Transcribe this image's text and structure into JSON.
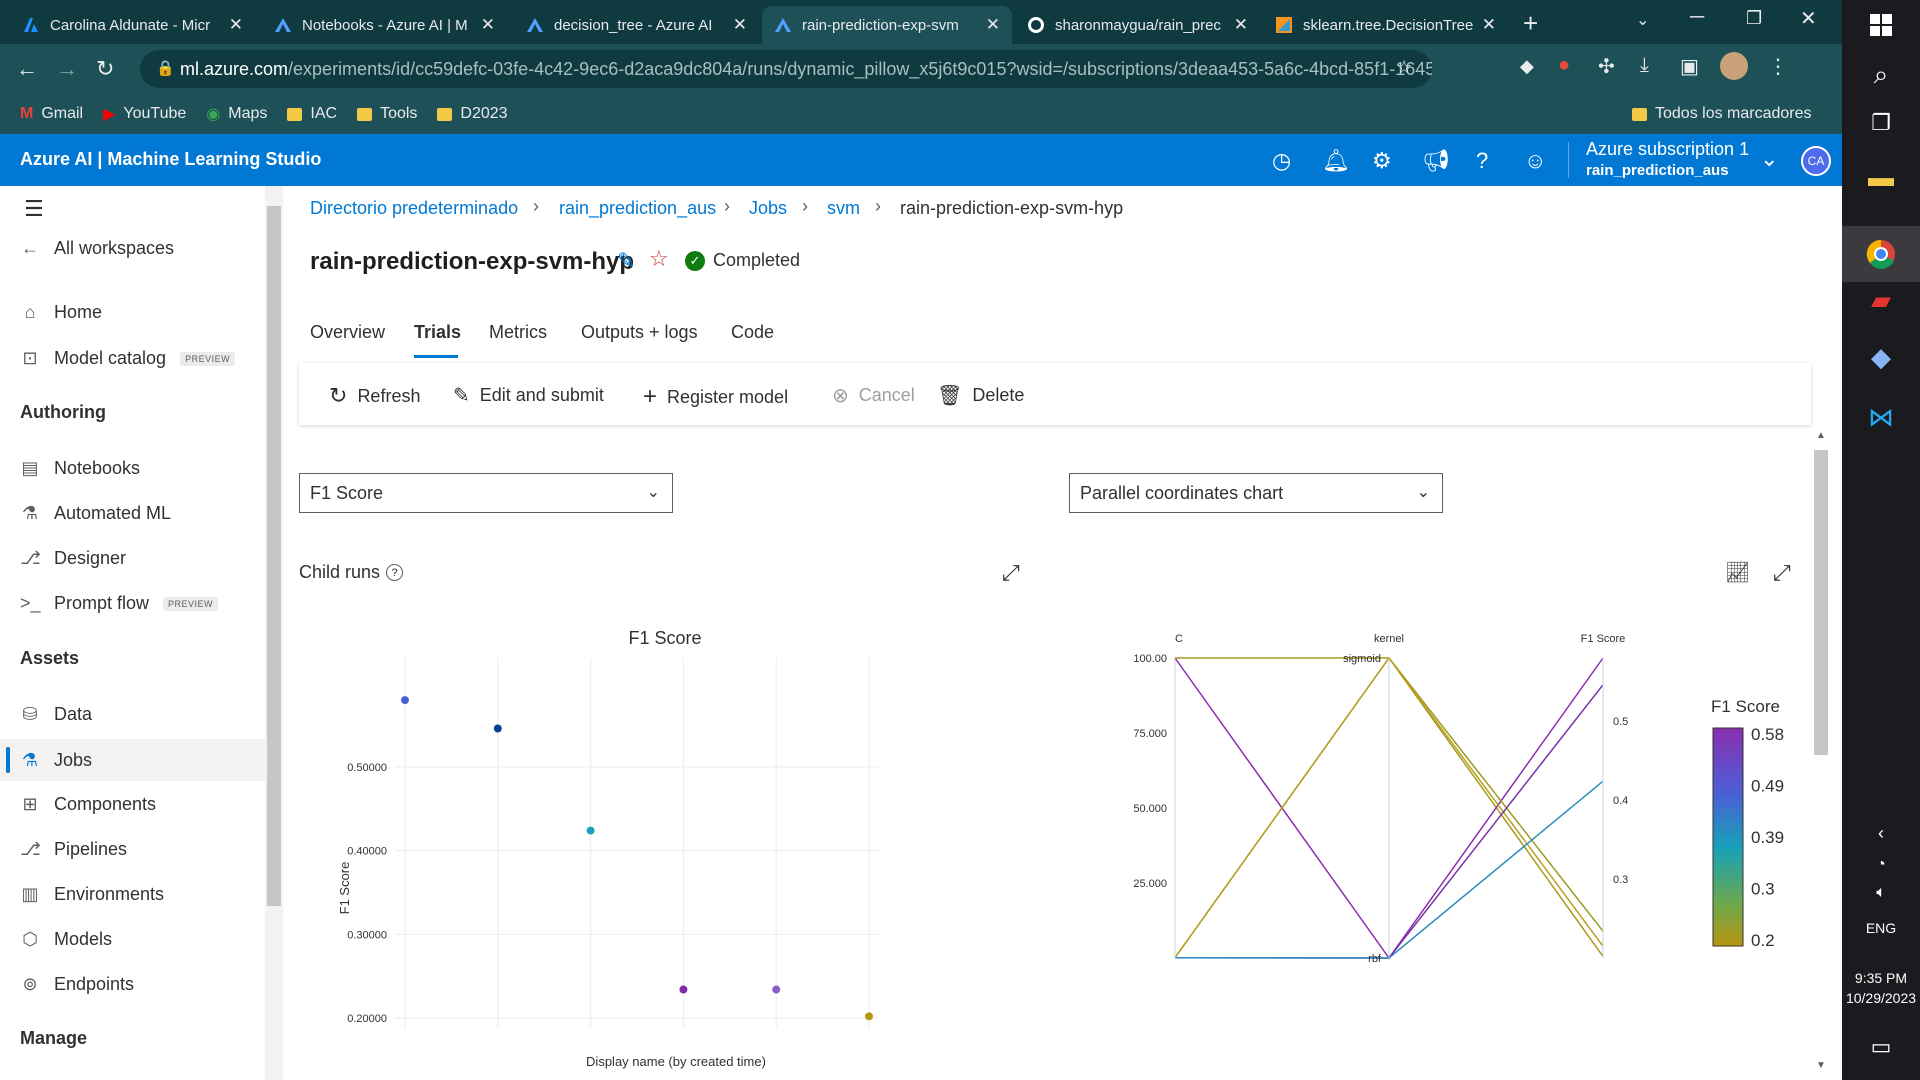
{
  "browser": {
    "tabs": [
      {
        "title": "Carolina Aldunate - Micr"
      },
      {
        "title": "Notebooks - Azure AI | M"
      },
      {
        "title": "decision_tree - Azure AI"
      },
      {
        "title": "rain-prediction-exp-svm"
      },
      {
        "title": "sharonmaygua/rain_prec"
      },
      {
        "title": "sklearn.tree.DecisionTree"
      }
    ],
    "url_host": "ml.azure.com",
    "url_path": "/experiments/id/cc59defc-03fe-4c42-9ec6-d2aca9dc804a/runs/dynamic_pillow_x5j6t9c015?wsid=/subscriptions/3deaa453-5a6c-4bcd-85f1-1645c...",
    "bookmarks": [
      "Gmail",
      "YouTube",
      "Maps",
      "IAC",
      "Tools",
      "D2023"
    ],
    "all_bookmarks": "Todos los marcadores"
  },
  "header": {
    "brand": "Azure AI | Machine Learning Studio",
    "subscription": "Azure subscription 1",
    "workspace": "rain_prediction_aus",
    "avatar": "CA"
  },
  "nav": {
    "all_workspaces": "All workspaces",
    "home": "Home",
    "model_catalog": "Model catalog",
    "preview": "PREVIEW",
    "authoring": "Authoring",
    "notebooks": "Notebooks",
    "automated_ml": "Automated ML",
    "designer": "Designer",
    "prompt_flow": "Prompt flow",
    "assets": "Assets",
    "data": "Data",
    "jobs": "Jobs",
    "components": "Components",
    "pipelines": "Pipelines",
    "environments": "Environments",
    "models": "Models",
    "endpoints": "Endpoints",
    "manage": "Manage"
  },
  "breadcrumb": [
    "Directorio predeterminado",
    "rain_prediction_aus",
    "Jobs",
    "svm",
    "rain-prediction-exp-svm-hyp"
  ],
  "page": {
    "title": "rain-prediction-exp-svm-hyp",
    "status": "Completed",
    "tabs": [
      "Overview",
      "Trials",
      "Metrics",
      "Outputs + logs",
      "Code"
    ]
  },
  "toolbar": {
    "refresh": "Refresh",
    "edit_submit": "Edit and submit",
    "register_model": "Register model",
    "cancel": "Cancel",
    "delete": "Delete"
  },
  "controls": {
    "metric_select": "F1 Score",
    "chart_select": "Parallel coordinates chart",
    "child_runs": "Child runs"
  },
  "taskbar": {
    "lang": "ENG",
    "time": "9:35 PM",
    "date": "10/29/2023"
  },
  "chart_data": [
    {
      "type": "scatter",
      "title": "F1 Score",
      "xlabel": "Display name (by created time)",
      "ylabel": "F1 Score",
      "yticks": [
        "0.20000",
        "0.30000",
        "0.40000",
        "0.50000"
      ],
      "ylim": [
        0.19,
        0.58
      ],
      "points": [
        {
          "x": 1,
          "y": 0.58,
          "color": "#4a5fd6"
        },
        {
          "x": 2,
          "y": 0.546,
          "color": "#0b3d91"
        },
        {
          "x": 3,
          "y": 0.424,
          "color": "#17a2b8"
        },
        {
          "x": 4,
          "y": 0.234,
          "color": "#7b2aa8"
        },
        {
          "x": 5,
          "y": 0.234,
          "color": "#8b5cc8"
        },
        {
          "x": 6,
          "y": 0.202,
          "color": "#b8960f"
        }
      ]
    },
    {
      "type": "parallel-coordinates",
      "axes": [
        "C",
        "kernel",
        "F1 Score"
      ],
      "c_ticks": [
        "100.00",
        "75.000",
        "50.000",
        "25.000"
      ],
      "c_range": [
        0,
        100
      ],
      "kernel_categories": [
        "sigmoid",
        "rbf"
      ],
      "f1_ticks": [
        "0.5",
        "0.4",
        "0.3"
      ],
      "f1_range": [
        0.2,
        0.58
      ],
      "colorbar_title": "F1 Score",
      "colorbar_ticks": [
        "0.58",
        "0.49",
        "0.39",
        "0.3",
        "0.2"
      ],
      "lines": [
        {
          "C": 100,
          "kernel": "sigmoid",
          "f1": 0.202,
          "color": "#a89a1e"
        },
        {
          "C": 100,
          "kernel": "rbf",
          "f1": 0.58,
          "color": "#8b2fb0"
        },
        {
          "C": 0.1,
          "kernel": "sigmoid",
          "f1": 0.234,
          "color": "#9a9a22"
        },
        {
          "C": 0.1,
          "kernel": "sigmoid",
          "f1": 0.215,
          "color": "#b8a020"
        },
        {
          "C": 0.1,
          "kernel": "rbf",
          "f1": 0.546,
          "color": "#7a30a8"
        },
        {
          "C": 0.1,
          "kernel": "rbf",
          "f1": 0.424,
          "color": "#2a8cc0"
        }
      ]
    }
  ]
}
